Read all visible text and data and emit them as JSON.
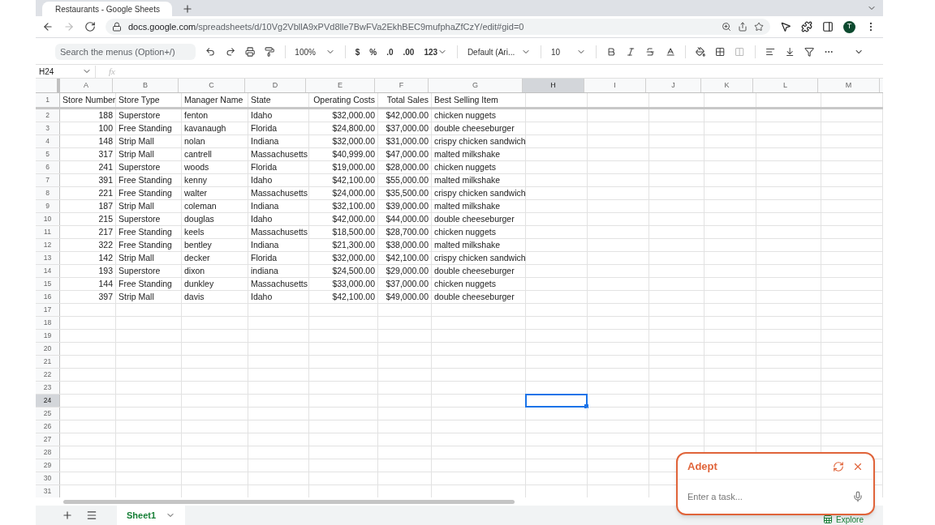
{
  "browser": {
    "tab": {
      "title": "Restaurants - Google Sheets"
    },
    "url": {
      "host": "docs.google.com",
      "path": "/spreadsheets/d/10Vg2VbllA9xPVd8lle7BwFVa2EkhBEC9mufphaZfCzY/edit#gid=0"
    },
    "back_disabled": false,
    "forward_disabled": true,
    "profile_initial": "T"
  },
  "toolbar": {
    "search": {
      "placeholder": "Search the menus (Option+/)"
    },
    "zoom": "100%",
    "currency": "$",
    "percent": "%",
    "decrease_decimals": ".0",
    "increase_decimals": ".00",
    "number_format": "123",
    "font": "Default (Ari...",
    "font_size": "10"
  },
  "formula_bar": {
    "name_box": "H24",
    "function_label": "fx"
  },
  "columns": [
    {
      "letter": "A",
      "selected": false
    },
    {
      "letter": "B",
      "selected": false
    },
    {
      "letter": "C",
      "selected": false
    },
    {
      "letter": "D",
      "selected": false
    },
    {
      "letter": "E",
      "selected": false
    },
    {
      "letter": "F",
      "selected": false
    },
    {
      "letter": "G",
      "selected": false
    },
    {
      "letter": "H",
      "selected": true
    },
    {
      "letter": "I",
      "selected": false
    },
    {
      "letter": "J",
      "selected": false
    },
    {
      "letter": "K",
      "selected": false
    },
    {
      "letter": "L",
      "selected": false
    },
    {
      "letter": "M",
      "selected": false
    }
  ],
  "rows": [
    {
      "number": "1",
      "selected": false,
      "cells": [
        "Store Number",
        "Store Type",
        "Manager Name",
        "State",
        "Operating Costs",
        "Total Sales",
        "Best Selling Item"
      ]
    },
    {
      "number": "2",
      "selected": false,
      "cells": [
        "188",
        "Superstore",
        "fenton",
        "Idaho",
        "$32,000.00",
        "$42,000.00",
        "chicken nuggets"
      ]
    },
    {
      "number": "3",
      "selected": false,
      "cells": [
        "100",
        "Free Standing",
        "kavanaugh",
        "Florida",
        "$24,800.00",
        "$37,000.00",
        "double cheeseburger"
      ]
    },
    {
      "number": "4",
      "selected": false,
      "cells": [
        "148",
        "Strip Mall",
        "nolan",
        "Indiana",
        "$32,000.00",
        "$31,000.00",
        "crispy chicken sandwich"
      ]
    },
    {
      "number": "5",
      "selected": false,
      "cells": [
        "317",
        "Strip Mall",
        "cantrell",
        "Massachusetts",
        "$40,999.00",
        "$47,000.00",
        "malted milkshake"
      ]
    },
    {
      "number": "6",
      "selected": false,
      "cells": [
        "241",
        "Superstore",
        "woods",
        "Florida",
        "$19,000.00",
        "$28,000.00",
        "chicken nuggets"
      ]
    },
    {
      "number": "7",
      "selected": false,
      "cells": [
        "391",
        "Free Standing",
        "kenny",
        "Idaho",
        "$42,100.00",
        "$55,000.00",
        "malted milkshake"
      ]
    },
    {
      "number": "8",
      "selected": false,
      "cells": [
        "221",
        "Free Standing",
        "walter",
        "Massachusetts",
        "$24,000.00",
        "$35,500.00",
        "crispy chicken sandwich"
      ]
    },
    {
      "number": "9",
      "selected": false,
      "cells": [
        "187",
        "Strip Mall",
        "coleman",
        "Indiana",
        "$32,100.00",
        "$39,000.00",
        "malted milkshake"
      ]
    },
    {
      "number": "10",
      "selected": false,
      "cells": [
        "215",
        "Superstore",
        "douglas",
        "Idaho",
        "$42,000.00",
        "$44,000.00",
        "double cheeseburger"
      ]
    },
    {
      "number": "11",
      "selected": false,
      "cells": [
        "217",
        "Free Standing",
        "keels",
        "Massachusetts",
        "$18,500.00",
        "$28,700.00",
        "chicken nuggets"
      ]
    },
    {
      "number": "12",
      "selected": false,
      "cells": [
        "322",
        "Free Standing",
        "bentley",
        "Indiana",
        "$21,300.00",
        "$38,000.00",
        "malted milkshake"
      ]
    },
    {
      "number": "13",
      "selected": false,
      "cells": [
        "142",
        "Strip Mall",
        "decker",
        "Florida",
        "$32,000.00",
        "$42,100.00",
        "crispy chicken sandwich"
      ]
    },
    {
      "number": "14",
      "selected": false,
      "cells": [
        "193",
        "Superstore",
        "dixon",
        "indiana",
        "$24,500.00",
        "$29,000.00",
        "double cheeseburger"
      ]
    },
    {
      "number": "15",
      "selected": false,
      "cells": [
        "144",
        "Free Standing",
        "dunkley",
        "Massachusetts",
        "$33,000.00",
        "$37,000.00",
        "chicken nuggets"
      ]
    },
    {
      "number": "16",
      "selected": false,
      "cells": [
        "397",
        "Strip Mall",
        "davis",
        "Idaho",
        "$42,100.00",
        "$49,000.00",
        "double cheeseburger"
      ]
    },
    {
      "number": "17",
      "selected": false
    },
    {
      "number": "18",
      "selected": false
    },
    {
      "number": "19",
      "selected": false
    },
    {
      "number": "20",
      "selected": false
    },
    {
      "number": "21",
      "selected": false
    },
    {
      "number": "22",
      "selected": false
    },
    {
      "number": "23",
      "selected": false
    },
    {
      "number": "24",
      "selected": true
    },
    {
      "number": "25",
      "selected": false
    },
    {
      "number": "26",
      "selected": false
    },
    {
      "number": "27",
      "selected": false
    },
    {
      "number": "28",
      "selected": false
    },
    {
      "number": "29",
      "selected": false
    },
    {
      "number": "30",
      "selected": false
    },
    {
      "number": "31",
      "selected": false
    }
  ],
  "sheet_tabs": [
    {
      "label": "Sheet1",
      "selected": true
    }
  ],
  "explore": {
    "label": "Explore"
  },
  "assistant": {
    "title": "Adept",
    "input": {
      "placeholder": "Enter a task..."
    }
  }
}
